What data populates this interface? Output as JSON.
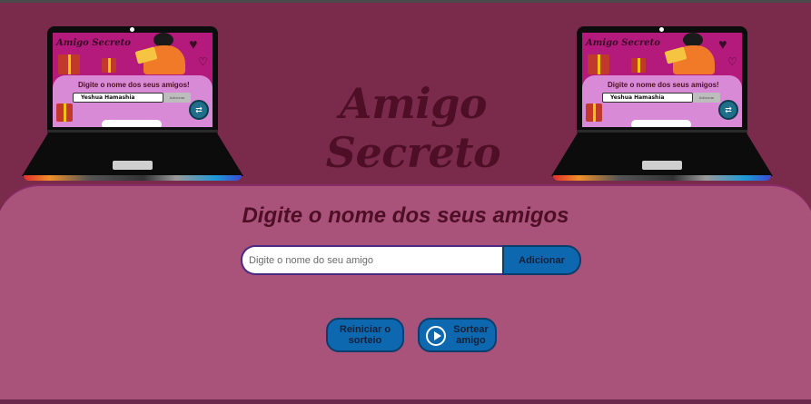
{
  "app": {
    "title": "Amigo Secreto"
  },
  "laptop_preview": {
    "screen_title": "Amigo Secreto",
    "screen_subtitle": "Digite o nome dos seus amigos!",
    "screen_input_value": "Yeshua Hamashia",
    "screen_button": "Adicionar"
  },
  "main": {
    "subtitle": "Digite o nome dos seus amigos",
    "input_placeholder": "Digite o nome do seu amigo",
    "input_value": "",
    "add_button": "Adicionar",
    "reset_button_line1": "Reiniciar o",
    "reset_button_line2": "sorteio",
    "draw_button_line1": "Sortear",
    "draw_button_line2": "amigo"
  },
  "colors": {
    "background": "#7a2b4c",
    "panel": "#a9537a",
    "title": "#4e0f26",
    "button": "#0d68b0"
  },
  "icons": [
    "play-circle-icon",
    "laptop-illustration",
    "gift-icon",
    "heart-icon"
  ]
}
